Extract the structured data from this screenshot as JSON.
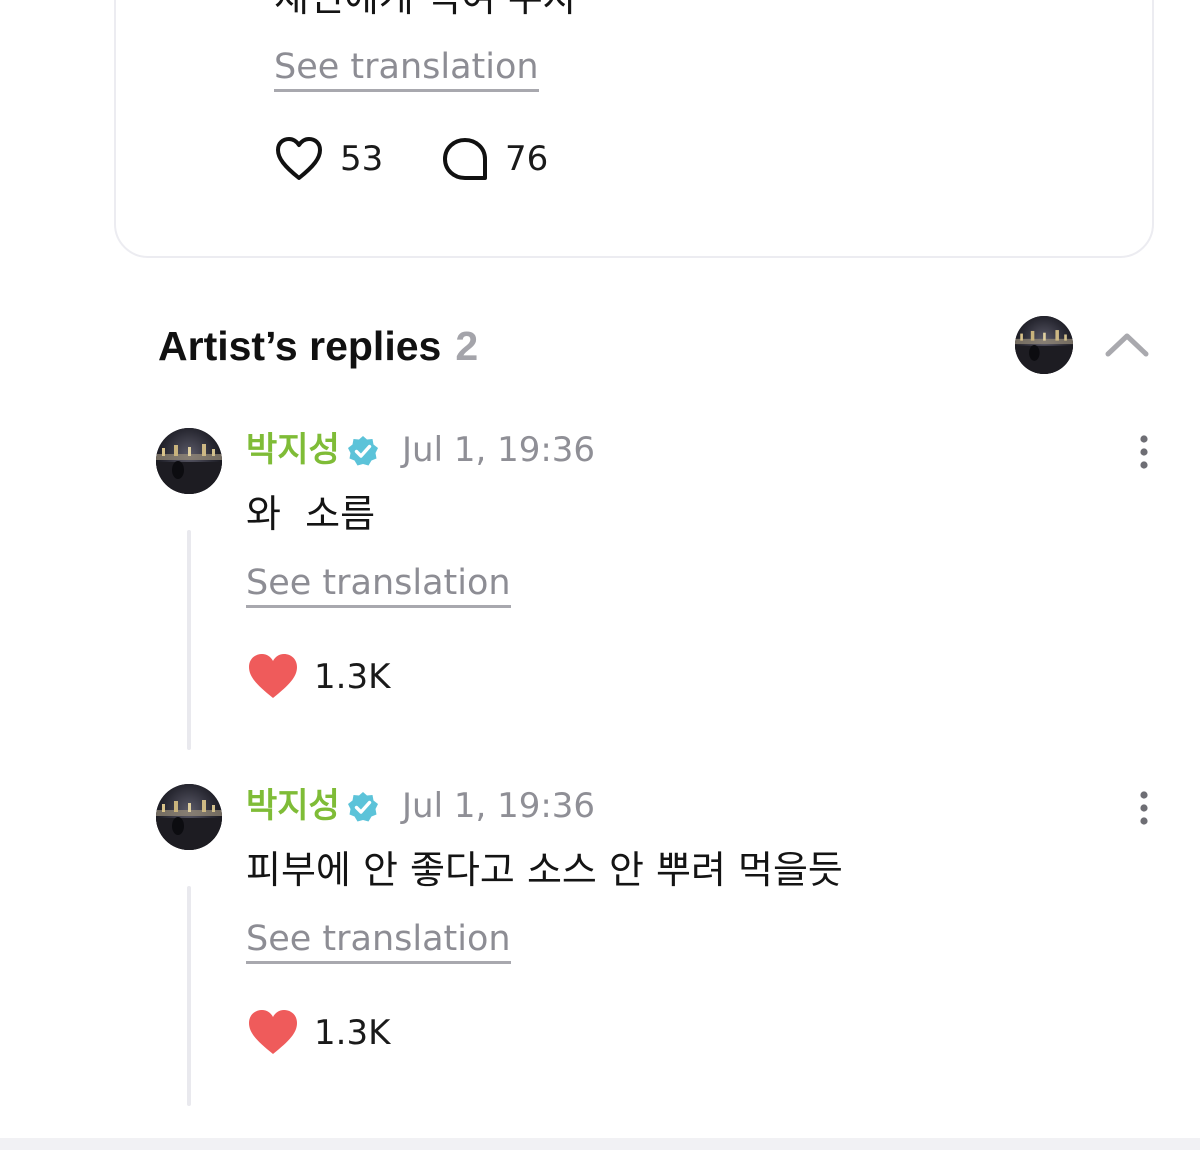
{
  "post": {
    "text": "재민에게 먹여 주자",
    "see_translation": "See translation",
    "likes": "53",
    "comments": "76",
    "like_icon": "heart-outline-icon",
    "comment_icon": "speech-bubble-icon"
  },
  "artist_replies": {
    "title": "Artist’s replies",
    "count": "2",
    "collapse_icon": "chevron-up-icon"
  },
  "replies": [
    {
      "author": "박지성",
      "time": "Jul 1, 19:36",
      "text": "와  소름",
      "see_translation": "See translation",
      "likes": "1.3K"
    },
    {
      "author": "박지성",
      "time": "Jul 1, 19:36",
      "text": "피부에 안 좋다고 소스 안 뿌려 먹을듯",
      "see_translation": "See translation",
      "likes": "1.3K"
    }
  ],
  "colors": {
    "author_name": "#7fbc37",
    "verified_badge": "#5cc3d9",
    "liked_heart": "#ef5b5b",
    "muted_text": "#8f8f96"
  }
}
